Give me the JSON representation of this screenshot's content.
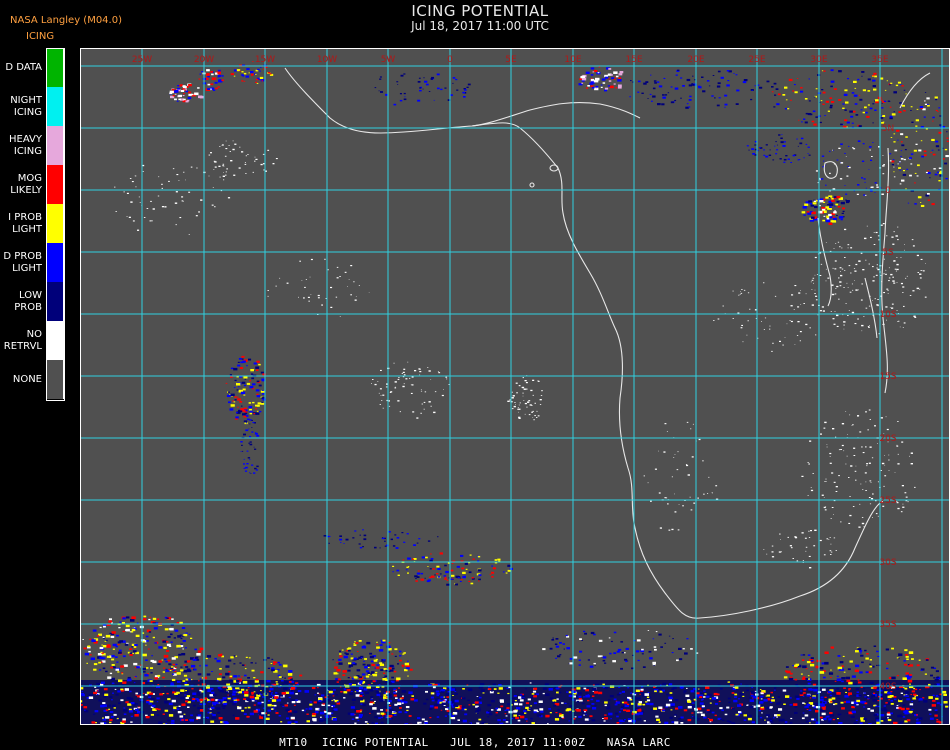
{
  "header": {
    "source": "NASA Langley (M04.0)",
    "title": "ICING POTENTIAL",
    "subtitle": "Jul 18, 2017 11:00 UTC"
  },
  "legend": {
    "title": "ICING",
    "items": [
      {
        "label": "D DATA",
        "color": "#00b400"
      },
      {
        "label": "NIGHT\nICING",
        "color": "#00f0f0"
      },
      {
        "label": "HEAVY\nICING",
        "color": "#e6a8dc"
      },
      {
        "label": "MOG\nLIKELY",
        "color": "#ff0000"
      },
      {
        "label": "I PROB\nLIGHT",
        "color": "#ffff00"
      },
      {
        "label": "D PROB\nLIGHT",
        "color": "#0000ff"
      },
      {
        "label": "LOW\nPROB",
        "color": "#00007a"
      },
      {
        "label": "NO\nRETRVL",
        "color": "#ffffff"
      },
      {
        "label": "NONE",
        "color": "#505050"
      }
    ]
  },
  "map": {
    "background": "#505050",
    "grid_color": "#30d0e0",
    "lon_labels": [
      "25W",
      "20W",
      "15W",
      "10W",
      "5W",
      "0",
      "5E",
      "10E",
      "15E",
      "20E",
      "25E",
      "30E",
      "35E"
    ],
    "lat_labels": [
      "5N",
      "0",
      "5S",
      "10S",
      "15S",
      "20S",
      "25S",
      "30S",
      "35S",
      "40S"
    ],
    "label_color": "#b01818"
  },
  "footer": "MT10  ICING POTENTIAL   JUL 18, 2017 11:00Z   NASA LARC"
}
